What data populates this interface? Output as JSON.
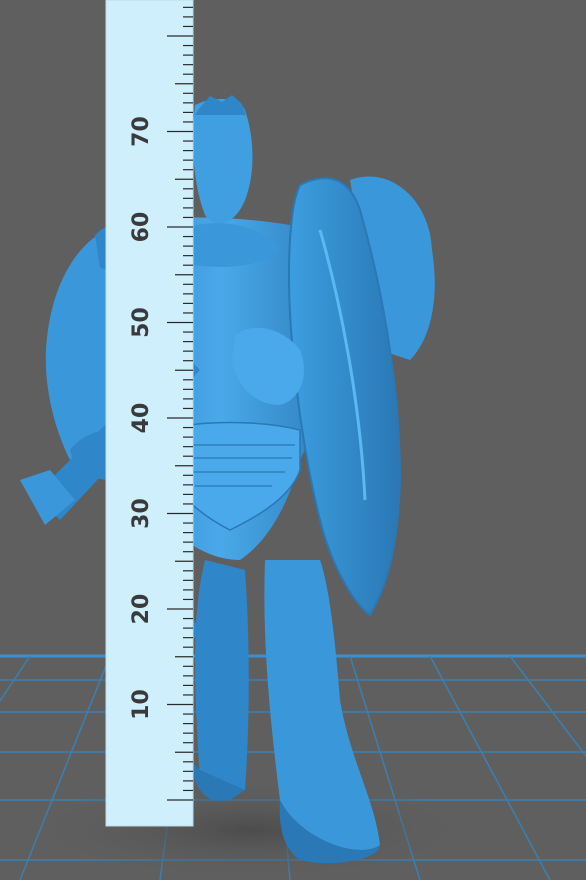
{
  "scene": {
    "background_color": "#5f5f5f",
    "floor_grid_color": "#3d7fb0",
    "model_color": "#3f9fe0",
    "ruler_color": "#cfeffc",
    "ruler": {
      "unit_labels": [
        "10",
        "20",
        "30",
        "40",
        "50",
        "60",
        "70"
      ]
    }
  }
}
